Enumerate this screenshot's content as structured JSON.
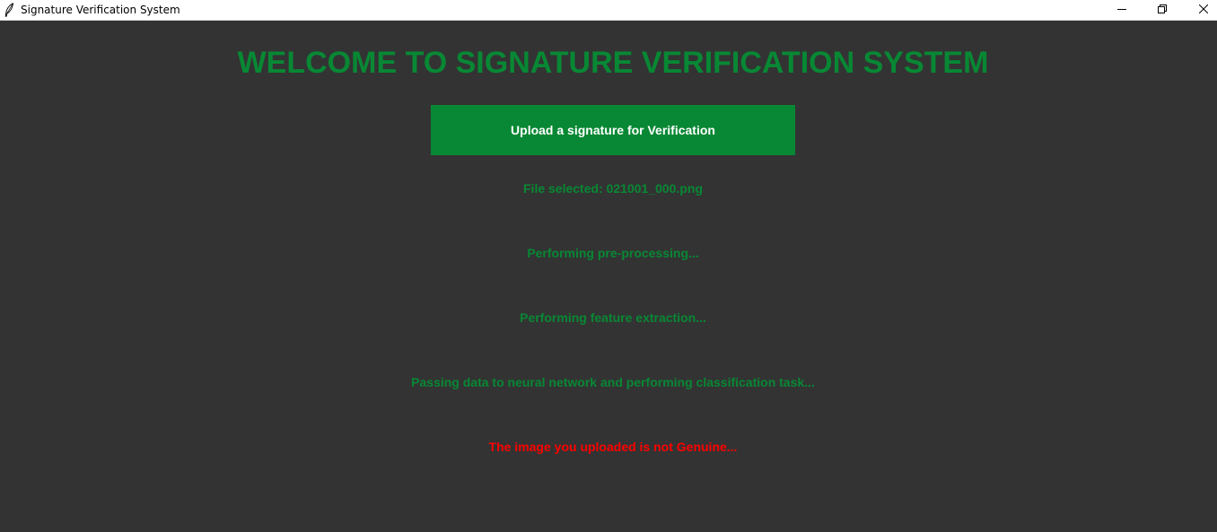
{
  "window": {
    "title": "Signature Verification System",
    "icon": "feather-icon",
    "controls": [
      "minimize-icon",
      "restore-icon",
      "close-icon"
    ],
    "background_color": "#333333"
  },
  "main": {
    "heading": "WELCOME TO SIGNATURE VERIFICATION SYSTEM",
    "heading_color": "#088834",
    "upload_button_label": "Upload a signature for Verification",
    "upload_button_color": "#088834",
    "status_lines": [
      {
        "text": "File selected: 021001_000.png",
        "color": "#088834"
      },
      {
        "text": "Performing pre-processing...",
        "color": "#088834"
      },
      {
        "text": "Performing feature extraction...",
        "color": "#088834"
      },
      {
        "text": "Passing data to neural network and performing classification task...",
        "color": "#088834"
      },
      {
        "text": "The image you uploaded is not Genuine...",
        "color": "#ff0000"
      }
    ]
  }
}
